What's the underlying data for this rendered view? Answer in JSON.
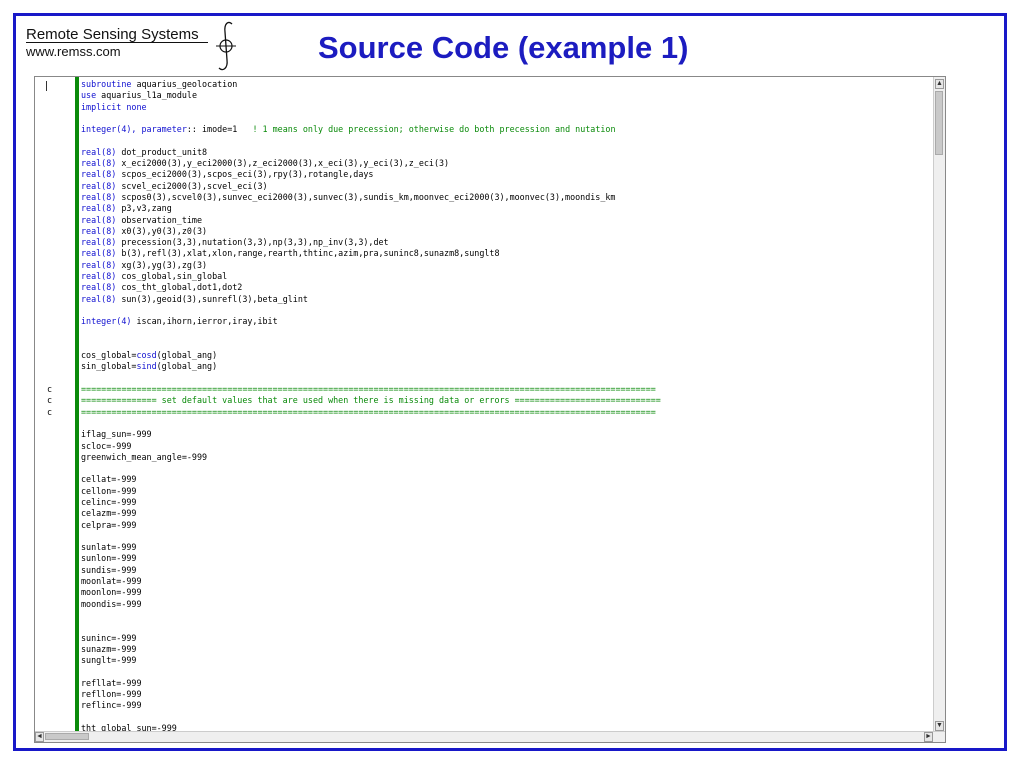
{
  "logo": {
    "name": "Remote Sensing Systems",
    "url": "www.remss.com"
  },
  "title": "Source Code (example 1)",
  "lines": [
    [
      [
        "kw",
        "subroutine"
      ],
      [
        "n",
        " aquarius_geolocation"
      ]
    ],
    [
      [
        "kw",
        "use"
      ],
      [
        "n",
        " aquarius_l1a_module"
      ]
    ],
    [
      [
        "kw",
        "implicit none"
      ]
    ],
    [],
    [
      [
        "kw",
        "integer(4), parameter"
      ],
      [
        "n",
        ":: imode=1   "
      ],
      [
        "cm",
        "! 1 means only due precession; otherwise do both precession and nutation"
      ]
    ],
    [],
    [
      [
        "kw",
        "real(8)"
      ],
      [
        "n",
        " dot_product_unit8"
      ]
    ],
    [
      [
        "kw",
        "real(8)"
      ],
      [
        "n",
        " x_eci2000(3),y_eci2000(3),z_eci2000(3),x_eci(3),y_eci(3),z_eci(3)"
      ]
    ],
    [
      [
        "kw",
        "real(8)"
      ],
      [
        "n",
        " scpos_eci2000(3),scpos_eci(3),rpy(3),rotangle,days"
      ]
    ],
    [
      [
        "kw",
        "real(8)"
      ],
      [
        "n",
        " scvel_eci2000(3),scvel_eci(3)"
      ]
    ],
    [
      [
        "kw",
        "real(8)"
      ],
      [
        "n",
        " scpos0(3),scvel0(3),sunvec_eci2000(3),sunvec(3),sundis_km,moonvec_eci2000(3),moonvec(3),moondis_km"
      ]
    ],
    [
      [
        "kw",
        "real(8)"
      ],
      [
        "n",
        " p3,v3,zang"
      ]
    ],
    [
      [
        "kw",
        "real(8)"
      ],
      [
        "n",
        " observation_time"
      ]
    ],
    [
      [
        "kw",
        "real(8)"
      ],
      [
        "n",
        " x0(3),y0(3),z0(3)"
      ]
    ],
    [
      [
        "kw",
        "real(8)"
      ],
      [
        "n",
        " precession(3,3),nutation(3,3),np(3,3),np_inv(3,3),det"
      ]
    ],
    [
      [
        "kw",
        "real(8)"
      ],
      [
        "n",
        " b(3),refl(3),xlat,xlon,range,rearth,thtinc,azim,pra,suninc8,sunazm8,sunglt8"
      ]
    ],
    [
      [
        "kw",
        "real(8)"
      ],
      [
        "n",
        " xg(3),yg(3),zg(3)"
      ]
    ],
    [
      [
        "kw",
        "real(8)"
      ],
      [
        "n",
        " cos_global,sin_global"
      ]
    ],
    [
      [
        "kw",
        "real(8)"
      ],
      [
        "n",
        " cos_tht_global,dot1,dot2"
      ]
    ],
    [
      [
        "kw",
        "real(8)"
      ],
      [
        "n",
        " sun(3),geoid(3),sunrefl(3),beta_glint"
      ]
    ],
    [],
    [
      [
        "kw",
        "integer(4)"
      ],
      [
        "n",
        " iscan,ihorn,ierror,iray,ibit"
      ]
    ],
    [],
    [],
    [
      [
        "n",
        "cos_global="
      ],
      [
        "kw",
        "cosd"
      ],
      [
        "n",
        "(global_ang)"
      ]
    ],
    [
      [
        "n",
        "sin_global="
      ],
      [
        "kw",
        "sind"
      ],
      [
        "n",
        "(global_ang)"
      ]
    ],
    [],
    [
      [
        "cm",
        "=================================================================================================================="
      ]
    ],
    [
      [
        "cm",
        "=============== set default values that are used when there is missing data or errors ============================="
      ]
    ],
    [
      [
        "cm",
        "=================================================================================================================="
      ]
    ],
    [],
    [
      [
        "n",
        "iflag_sun=-999"
      ]
    ],
    [
      [
        "n",
        "scloc=-999"
      ]
    ],
    [
      [
        "n",
        "greenwich_mean_angle=-999"
      ]
    ],
    [],
    [
      [
        "n",
        "cellat=-999"
      ]
    ],
    [
      [
        "n",
        "cellon=-999"
      ]
    ],
    [
      [
        "n",
        "celinc=-999"
      ]
    ],
    [
      [
        "n",
        "celazm=-999"
      ]
    ],
    [
      [
        "n",
        "celpra=-999"
      ]
    ],
    [],
    [
      [
        "n",
        "sunlat=-999"
      ]
    ],
    [
      [
        "n",
        "sunlon=-999"
      ]
    ],
    [
      [
        "n",
        "sundis=-999"
      ]
    ],
    [
      [
        "n",
        "moonlat=-999"
      ]
    ],
    [
      [
        "n",
        "moonlon=-999"
      ]
    ],
    [
      [
        "n",
        "moondis=-999"
      ]
    ],
    [],
    [],
    [
      [
        "n",
        "suninc=-999"
      ]
    ],
    [
      [
        "n",
        "sunazm=-999"
      ]
    ],
    [
      [
        "n",
        "sunglt=-999"
      ]
    ],
    [],
    [
      [
        "n",
        "refllat=-999"
      ]
    ],
    [
      [
        "n",
        "refllon=-999"
      ]
    ],
    [
      [
        "n",
        "reflinc=-999"
      ]
    ],
    [],
    [
      [
        "n",
        "tht_global_sun=-999"
      ]
    ]
  ],
  "comment_marks": [
    {
      "line": 27,
      "text": "c"
    },
    {
      "line": 28,
      "text": "c"
    },
    {
      "line": 29,
      "text": "c"
    }
  ],
  "scroll": {
    "up": "▲",
    "down": "▼",
    "left": "◄",
    "right": "►"
  },
  "colors": {
    "keyword": "#1010d0",
    "comment": "#0a8a0a",
    "title": "#1c1cc0",
    "frame": "#1818c8"
  }
}
